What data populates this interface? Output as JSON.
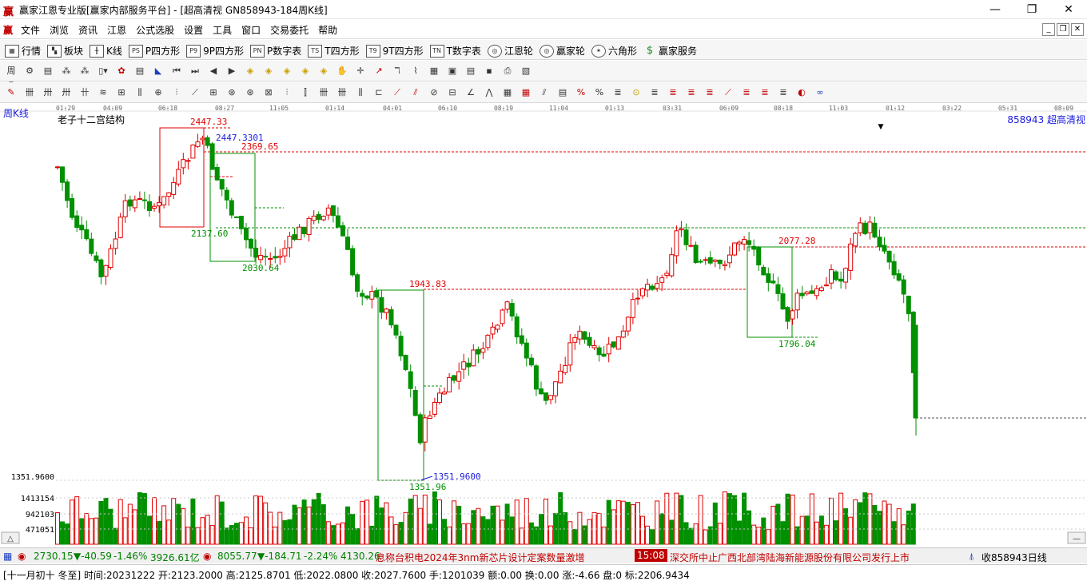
{
  "window": {
    "title": "赢家江恩专业版[赢家内部服务平台] - [超高清视  GN858943-184周K线]",
    "app_icon": "赢",
    "controls": [
      "—",
      "❐",
      "✕"
    ]
  },
  "menubar": {
    "items": [
      "文件",
      "浏览",
      "资讯",
      "江恩",
      "公式选股",
      "设置",
      "工具",
      "窗口",
      "交易委托",
      "帮助"
    ]
  },
  "toolbar1": {
    "items": [
      {
        "icon": "▦",
        "label": "行情"
      },
      {
        "icon": "▚",
        "label": "板块"
      },
      {
        "icon": "╫",
        "label": "K线"
      },
      {
        "icon": "PS",
        "label": "P四方形"
      },
      {
        "icon": "P9",
        "label": "9P四方形"
      },
      {
        "icon": "PN",
        "label": "P数字表"
      },
      {
        "icon": "TS",
        "label": "T四方形"
      },
      {
        "icon": "T9",
        "label": "9T四方形"
      },
      {
        "icon": "TN",
        "label": "T数字表"
      },
      {
        "icon": "◎",
        "label": "江恩轮"
      },
      {
        "icon": "◎",
        "label": "赢家轮"
      },
      {
        "icon": "✶",
        "label": "六角形"
      },
      {
        "icon": "$",
        "label": "赢家服务"
      }
    ]
  },
  "chart": {
    "period_label": "周K线",
    "indicator_label": "老子十二宫结构",
    "symbol_label": "858943  超高清视",
    "date_ticks": [
      "01-29",
      "04-09",
      "06-18",
      "08-27",
      "11-05",
      "01-14",
      "04-01",
      "06-10",
      "08-19",
      "11-04",
      "01-13",
      "03-31",
      "06-09",
      "08-18",
      "11-03",
      "01-12",
      "03-22",
      "05-31",
      "08-09"
    ],
    "annotations": [
      "2447.33",
      "2447.3301",
      "2369.65",
      "2137.60",
      "2030.64",
      "1943.83",
      "2077.28",
      "1796.04",
      "1351.96",
      "1351.9600"
    ],
    "left_scale": [
      "1351.9600",
      "1413154",
      "942103",
      "471051"
    ],
    "colors": {
      "up": "#e00000",
      "down": "#009000",
      "level": "#e00000",
      "box_red": "#e00000",
      "box_green": "#009000",
      "blue": "#1a1adc"
    }
  },
  "statusbar": {
    "idx1_value": "2730.15",
    "idx1_change": "▼-40.59",
    "idx1_pct": "-1.46%",
    "idx1_amount": "3926.61亿",
    "idx2_value": "8055.77",
    "idx2_change": "▼-184.71",
    "idx2_pct": "-2.24%",
    "idx2_amount": "4130.26",
    "news1": "息称台积电2024年3nm新芯片设计定案数量激增",
    "news_time": "15:08",
    "news2": "深交所中止广西北部湾陆海新能源股份有限公司发行上市",
    "right_label": "收858943日线"
  },
  "infobar": {
    "text": "[十一月初十 冬至] 时间:20231222 开:2123.2000 高:2125.8701 低:2022.0800 收:2027.7600 手:1201039 额:0.00 换:0.00 涨:-4.66 盘:0 标:2206.9434"
  }
}
